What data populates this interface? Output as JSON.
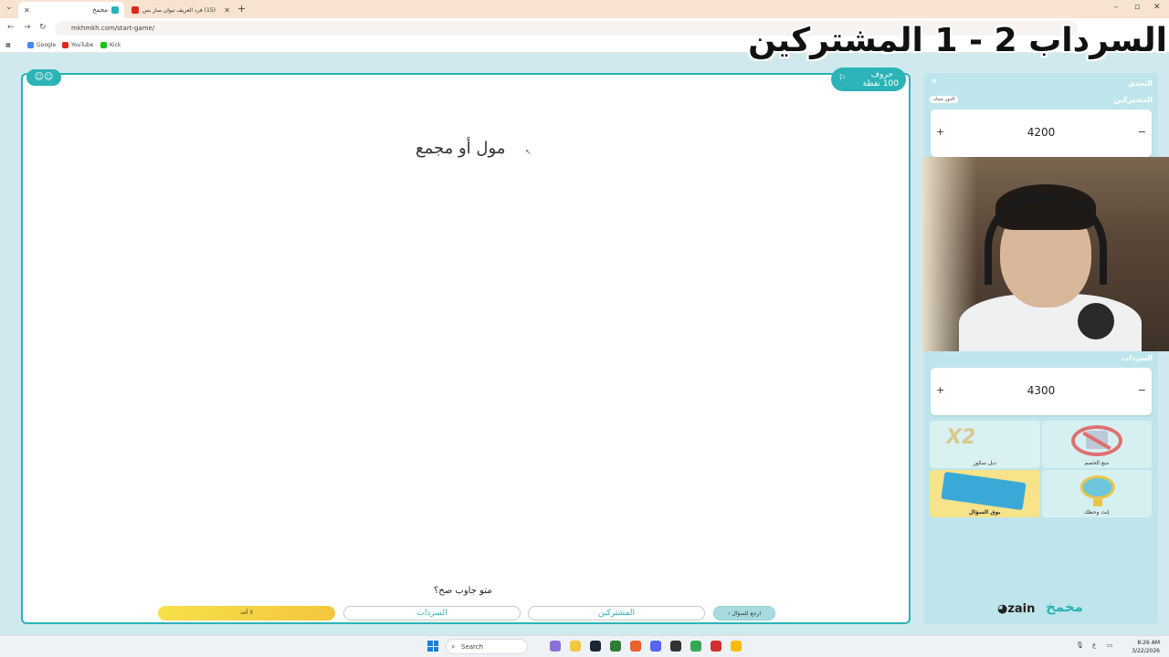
{
  "browser": {
    "tabs": [
      {
        "title": "مخمخ",
        "active": true
      },
      {
        "title": "(15) فرد العريف تيوان صار بس ال...",
        "active": false
      }
    ],
    "url": "mkhmkh.com/start-game/",
    "bookmarks": [
      "Google",
      "YouTube",
      "Kick"
    ]
  },
  "overlay_title": "السرداب 2 - 1 المشتركين",
  "game": {
    "emoji_controls": "☺☺",
    "category": {
      "name": "حروف",
      "points": "100 نقطة"
    },
    "question": "مول أو مجمع",
    "who_answered_prompt": "متو جاوب صح؟",
    "buttons": {
      "none": "لا أحد",
      "team_a": "السرداب",
      "team_b": "المشتركين",
      "back": "ارجع للسؤال"
    }
  },
  "sidebar": {
    "header": "التحدي",
    "teams": [
      {
        "name": "المشتركين",
        "score": "4200",
        "turn_badge": "الدور عندك"
      },
      {
        "name": "السرداب",
        "score": "4300"
      }
    ],
    "powerups": [
      {
        "name": "منع الخصم",
        "icon": "no-entry-icon"
      },
      {
        "name": "دبل سكور",
        "icon": "x2-icon"
      },
      {
        "name": "إنت وحظك",
        "icon": "wheel-icon"
      },
      {
        "name": "بوق السؤال",
        "icon": "cards-icon"
      }
    ],
    "sponsor": "zain",
    "brand": "مخمخ"
  },
  "taskbar": {
    "search_placeholder": "Search",
    "time": "8:26 AM",
    "date": "3/22/2026"
  },
  "colors": {
    "accent": "#2bb3b7",
    "panel_bg": "#bfe5ec",
    "yellow": "#f3d24a"
  }
}
